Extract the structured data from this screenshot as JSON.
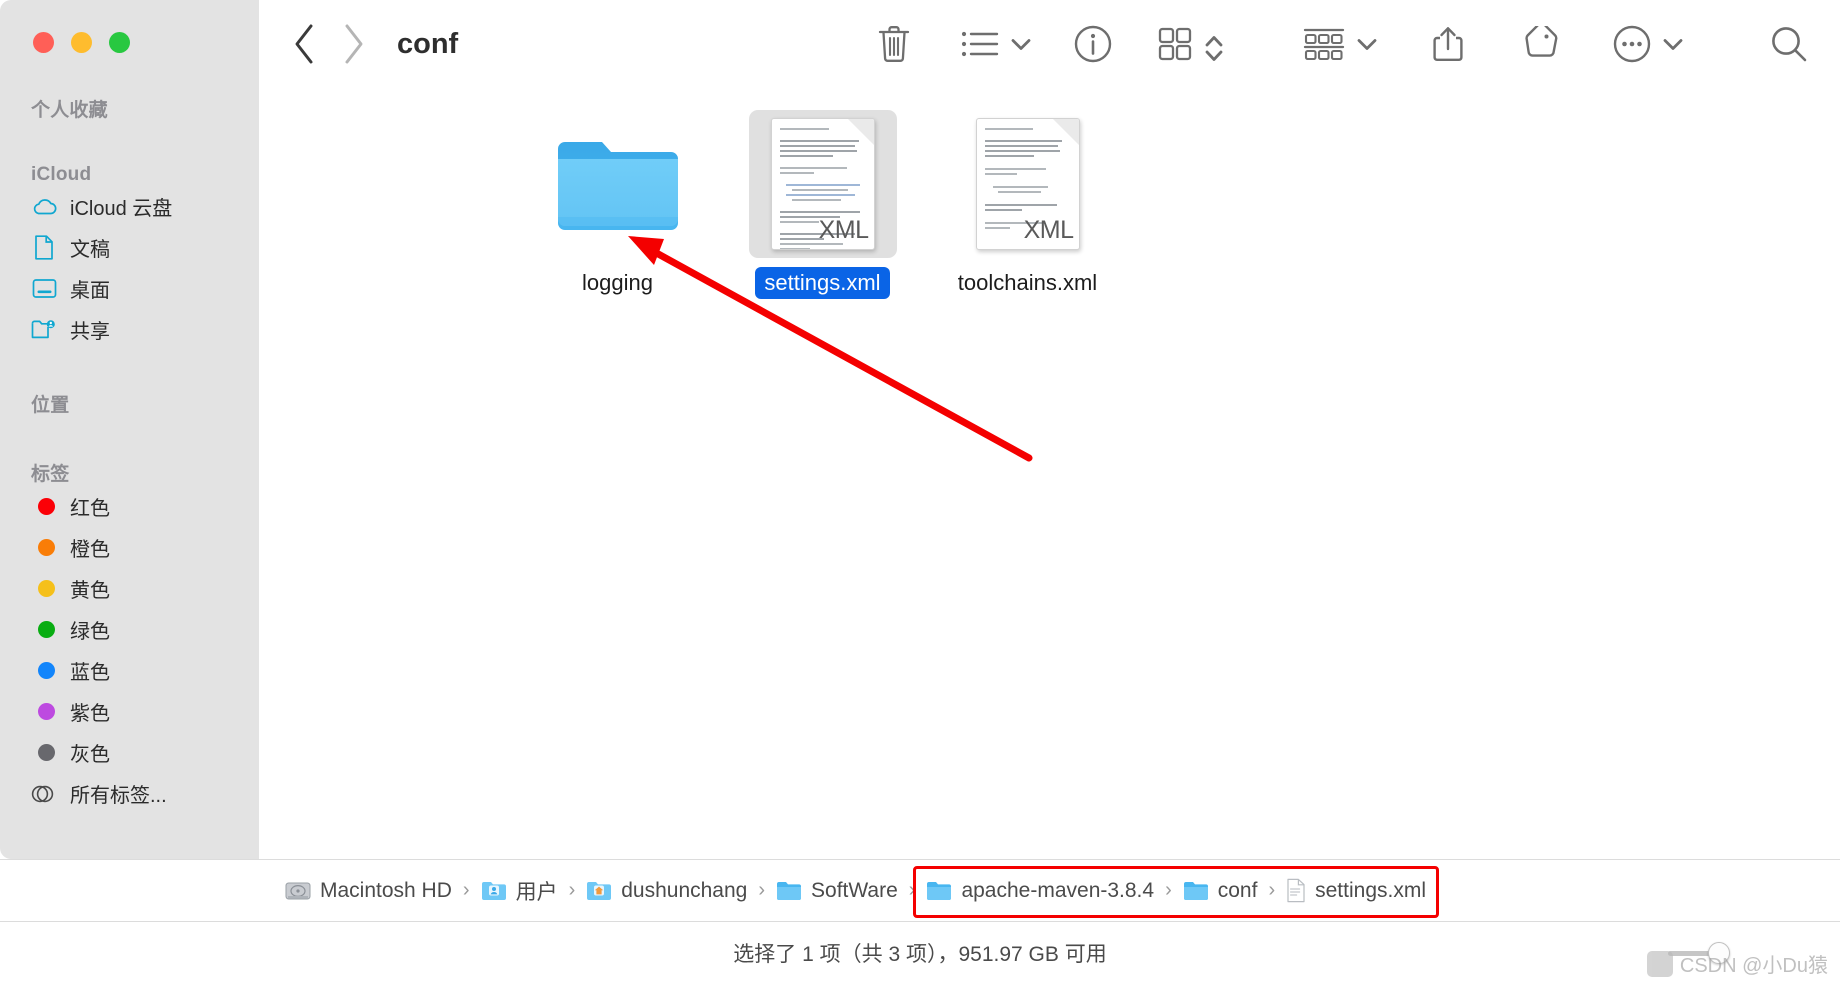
{
  "window": {
    "title": "conf",
    "traffic_lights": [
      {
        "name": "close",
        "color": "#ff5f57"
      },
      {
        "name": "minimize",
        "color": "#febc2e"
      },
      {
        "name": "maximize",
        "color": "#28c840"
      }
    ]
  },
  "sidebar": {
    "sections": [
      {
        "title": "个人收藏",
        "items": []
      },
      {
        "title": "iCloud",
        "items": [
          {
            "label": "iCloud 云盘",
            "icon": "cloud-icon"
          },
          {
            "label": "文稿",
            "icon": "document-icon"
          },
          {
            "label": "桌面",
            "icon": "desktop-icon"
          },
          {
            "label": "共享",
            "icon": "shared-folder-icon"
          }
        ]
      },
      {
        "title": "位置",
        "items": []
      },
      {
        "title": "标签",
        "items": [
          {
            "label": "红色",
            "icon": "tag-dot-icon",
            "color": "#fb0007"
          },
          {
            "label": "橙色",
            "icon": "tag-dot-icon",
            "color": "#f97d07"
          },
          {
            "label": "黄色",
            "icon": "tag-dot-icon",
            "color": "#f5c01a"
          },
          {
            "label": "绿色",
            "icon": "tag-dot-icon",
            "color": "#09ad12"
          },
          {
            "label": "蓝色",
            "icon": "tag-dot-icon",
            "color": "#1285fb"
          },
          {
            "label": "紫色",
            "icon": "tag-dot-icon",
            "color": "#c martin"
          },
          {
            "label": "灰色",
            "icon": "tag-dot-icon",
            "color": "#68686d"
          }
        ]
      }
    ],
    "all_tags": {
      "label": "所有标签...",
      "icon": "all-tags-icon"
    },
    "tag_colors": [
      "#fb0007",
      "#f97d07",
      "#f5c01a",
      "#09ad12",
      "#1285fb",
      "#bd4ae0",
      "#68686d"
    ]
  },
  "toolbar": {
    "back": "back-chevron",
    "forward": "forward-chevron",
    "buttons": [
      {
        "name": "trash-icon",
        "label": "删除"
      },
      {
        "name": "list-view-icon",
        "label": "显示方式"
      },
      {
        "name": "info-icon",
        "label": "显示简介"
      },
      {
        "name": "grid-arrange-icon",
        "label": "排列方式"
      },
      {
        "name": "group-icon",
        "label": "分组"
      },
      {
        "name": "share-icon",
        "label": "共享"
      },
      {
        "name": "tag-icon",
        "label": "标签"
      },
      {
        "name": "more-icon",
        "label": "更多"
      },
      {
        "name": "search-icon",
        "label": "搜索"
      }
    ]
  },
  "files": [
    {
      "name": "logging",
      "type": "folder",
      "selected": false
    },
    {
      "name": "settings.xml",
      "type": "xml",
      "selected": true,
      "badge": "XML"
    },
    {
      "name": "toolchains.xml",
      "type": "xml",
      "selected": false,
      "badge": "XML"
    }
  ],
  "breadcrumb": [
    {
      "label": "Macintosh HD",
      "icon": "harddisk-icon"
    },
    {
      "label": "用户",
      "icon": "users-folder-icon"
    },
    {
      "label": "dushunchang",
      "icon": "home-folder-icon"
    },
    {
      "label": "SoftWare",
      "icon": "folder-icon"
    },
    {
      "label": "apache-maven-3.8.4",
      "icon": "folder-icon"
    },
    {
      "label": "conf",
      "icon": "folder-icon"
    },
    {
      "label": "settings.xml",
      "icon": "xml-file-icon"
    }
  ],
  "breadcrumb_separator": "›",
  "status": {
    "text": "选择了 1 项（共 3 项），951.97 GB 可用"
  },
  "annotations": {
    "arrow_color": "#f40000",
    "highlight_color": "#f40000"
  },
  "watermark": {
    "text": "CSDN @小Du猿"
  }
}
